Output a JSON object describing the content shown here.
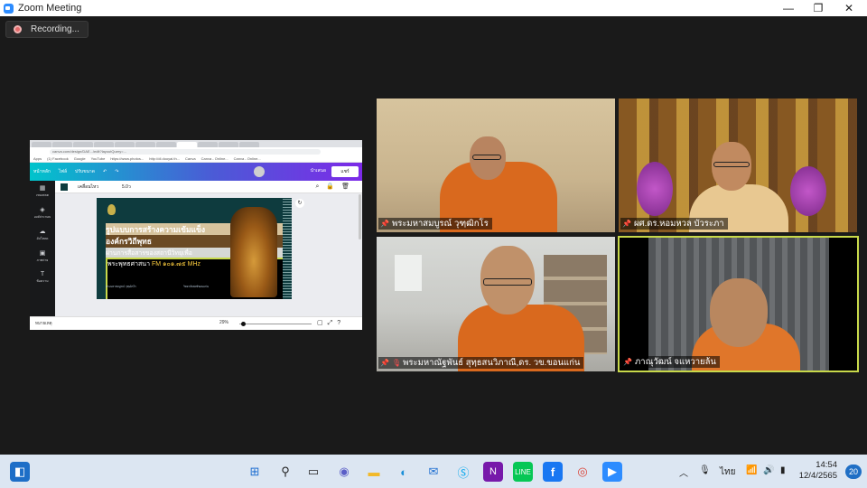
{
  "window": {
    "title": "Zoom Meeting",
    "controls": {
      "minimize": "—",
      "maximize": "❐",
      "close": "✕"
    }
  },
  "recording": {
    "label": "Recording..."
  },
  "shared_screen": {
    "url": "canva.com/design/DAE.../edit?layoutQuery=...",
    "bookmarks": [
      "Apps",
      "(1) Facebook",
      "Google",
      "YouTube",
      "https://www.photos...",
      "http://dl.dooyai.th...",
      "Canva",
      "Canva - Online...",
      "Canva - Online..."
    ],
    "canva_nav": [
      "หน้าหลัก",
      "ไฟล์",
      "ปรับขนาด"
    ],
    "present_label": "นำเสนอ",
    "share_label": "แชร์",
    "toolbar": {
      "animate": "เคลื่อนไหว",
      "duration": "5.0ว"
    },
    "sidebar": [
      {
        "icon": "▦",
        "label": "เทมเพลต"
      },
      {
        "icon": "◈",
        "label": "องค์ประกอบ"
      },
      {
        "icon": "☁",
        "label": "อัปโหลด"
      },
      {
        "icon": "▣",
        "label": "ภาพถ่าย"
      },
      {
        "icon": "T",
        "label": "ข้อความ"
      }
    ],
    "slide": {
      "line1": "รูปแบบการสร้างความเข้มแข็ง",
      "line2": "องค์กรวิถีพุทธ",
      "line3": "ผ่านการสื่อสารของสถานีวิทยุเพื่อ",
      "line4_prefix": "พระพุทธศาสนา ",
      "line4_highlight": "FM ๑๐๑.๗๕ MHz",
      "small_left": "พระมหาสมบูรณ์ วุฑฺฒิกโร",
      "small_right": "วิทยาลัยสงฆ์ขอนแก่น"
    },
    "footer": {
      "notes": "หมายเหตุ",
      "zoom": "29%"
    }
  },
  "participants": [
    {
      "name": "พระมหาสมบูรณ์ วุฑฺฒิกโร",
      "muted": false
    },
    {
      "name": "ผศ.ดร.หอมหวล บัวระภา",
      "muted": false
    },
    {
      "name": "พระมหาณัฐพันธ์ สุทฺธสนวิภาณี,ดร. วข.ขอนแก่น",
      "muted": true
    },
    {
      "name": "ภาณุวัฒน์ จแหวายล้น",
      "muted": false
    }
  ],
  "active_speaker_color": "#c8d94a",
  "taskbar": {
    "apps": [
      "widgets-icon",
      "start-icon",
      "search-icon",
      "task-view-icon",
      "teams-icon",
      "file-explorer-icon",
      "edge-icon",
      "mail-icon",
      "skype-icon",
      "onenote-icon",
      "line-icon",
      "facebook-icon",
      "chrome-icon",
      "zoom-icon"
    ],
    "language": "ไทย",
    "time": "14:54",
    "date": "12/4/2565",
    "notifications": "20"
  }
}
